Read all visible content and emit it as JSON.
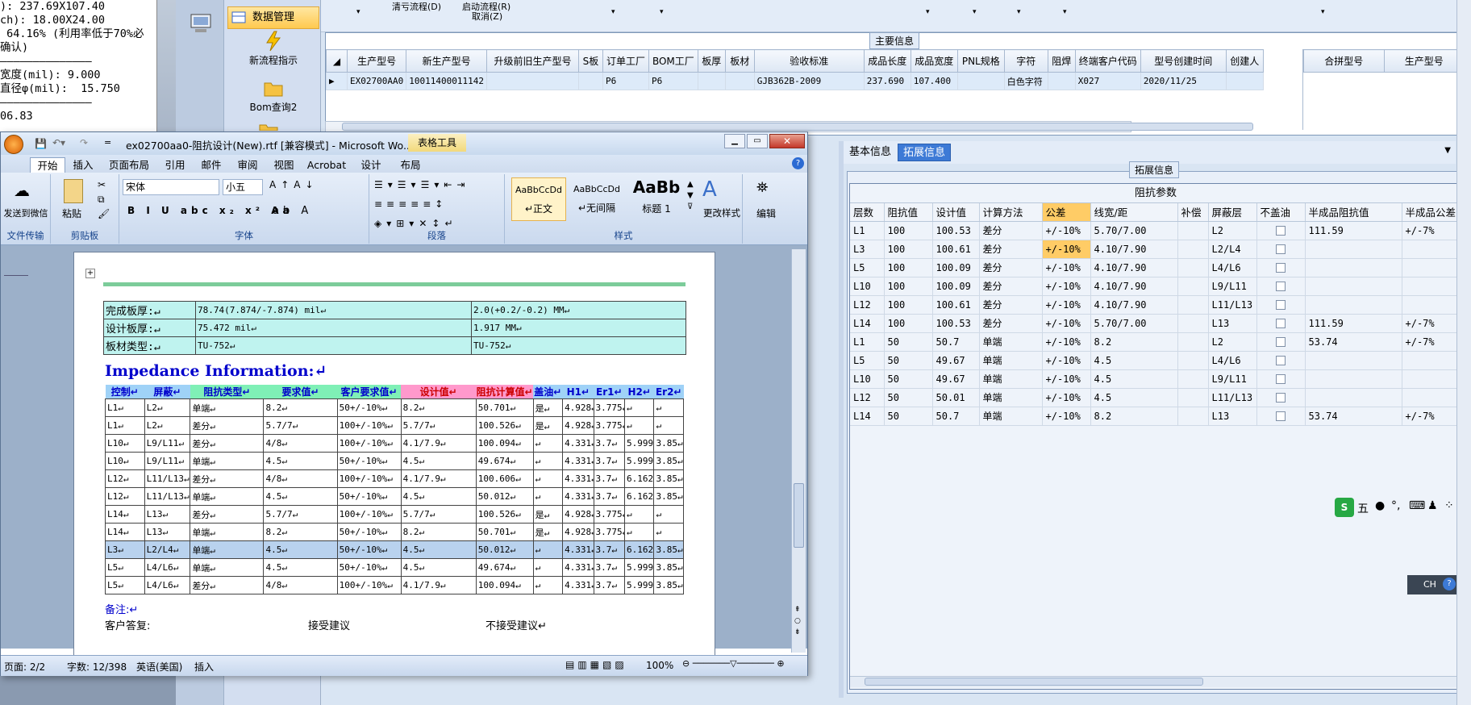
{
  "left_text": [
    "): 237.69X107.40",
    "ch): 18.00X24.00",
    " 64.16% (利用率低于70%必",
    "确认)",
    "——————————————",
    "宽度(mil): 9.000",
    "直径φ(mil):  15.750",
    "——————————————",
    "06.83"
  ],
  "nav": {
    "selected": "数据管理",
    "items": [
      "新流程指示",
      "Bom查询2"
    ]
  },
  "topbar": {
    "items": [
      "清亏流程(D)",
      "启动流程(R)",
      "取消(Z)"
    ]
  },
  "main": {
    "caption": "主要信息",
    "columns": [
      "生产型号",
      "新生产型号",
      "升级前旧生产型号",
      "S板",
      "订单工厂",
      "BOM工厂",
      "板厚",
      "板材",
      "验收标准",
      "成品长度",
      "成品宽度",
      "PNL规格",
      "字符",
      "阻焊",
      "终端客户代码",
      "型号创建时间",
      "创建人"
    ],
    "row": [
      "EX02700AA0",
      "10011400011142",
      "",
      "",
      "P6",
      "P6",
      "",
      "",
      "GJB362B-2009",
      "237.690",
      "107.400",
      "",
      "白色字符",
      "",
      "X027",
      "2020/11/25",
      ""
    ],
    "right_columns": [
      "合拼型号",
      "生产型号"
    ]
  },
  "panel2": {
    "tabs": [
      "基本信息",
      "拓展信息"
    ],
    "active": "拓展信息",
    "caption": "拓展信息",
    "grid_title": "阻抗参数",
    "columns": [
      "层数",
      "阻抗值",
      "设计值",
      "计算方法",
      "公差",
      "线宽/距",
      "补偿",
      "屏蔽层",
      "不盖油",
      "半成品阻抗值",
      "半成品公差"
    ],
    "rows": [
      [
        "L1",
        "100",
        "100.53",
        "差分",
        "+/-10%",
        "5.70/7.00",
        "",
        "L2",
        "",
        "111.59",
        "+/-7%"
      ],
      [
        "L3",
        "100",
        "100.61",
        "差分",
        "+/-10%",
        "4.10/7.90",
        "",
        "L2/L4",
        "",
        "",
        ""
      ],
      [
        "L5",
        "100",
        "100.09",
        "差分",
        "+/-10%",
        "4.10/7.90",
        "",
        "L4/L6",
        "",
        "",
        ""
      ],
      [
        "L10",
        "100",
        "100.09",
        "差分",
        "+/-10%",
        "4.10/7.90",
        "",
        "L9/L11",
        "",
        "",
        ""
      ],
      [
        "L12",
        "100",
        "100.61",
        "差分",
        "+/-10%",
        "4.10/7.90",
        "",
        "L11/L13",
        "",
        "",
        ""
      ],
      [
        "L14",
        "100",
        "100.53",
        "差分",
        "+/-10%",
        "5.70/7.00",
        "",
        "L13",
        "",
        "111.59",
        "+/-7%"
      ],
      [
        "L1",
        "50",
        "50.7",
        "单端",
        "+/-10%",
        "8.2",
        "",
        "L2",
        "",
        "53.74",
        "+/-7%"
      ],
      [
        "L5",
        "50",
        "49.67",
        "单端",
        "+/-10%",
        "4.5",
        "",
        "L4/L6",
        "",
        "",
        ""
      ],
      [
        "L10",
        "50",
        "49.67",
        "单端",
        "+/-10%",
        "4.5",
        "",
        "L9/L11",
        "",
        "",
        ""
      ],
      [
        "L12",
        "50",
        "50.01",
        "单端",
        "+/-10%",
        "4.5",
        "",
        "L11/L13",
        "",
        "",
        ""
      ],
      [
        "L14",
        "50",
        "50.7",
        "单端",
        "+/-10%",
        "8.2",
        "",
        "L13",
        "",
        "53.74",
        "+/-7%"
      ]
    ]
  },
  "word": {
    "title": "ex02700aa0-阻抗设计(New).rtf [兼容模式] - Microsoft Wo...",
    "context_tab": "表格工具",
    "tabs": [
      "开始",
      "插入",
      "页面布局",
      "引用",
      "邮件",
      "审阅",
      "视图",
      "Acrobat",
      "设计",
      "布局"
    ],
    "font": "宋体",
    "size": "小五",
    "groups": [
      "文件传输",
      "剪贴板",
      "字体",
      "段落",
      "样式",
      "编辑"
    ],
    "send_label": "发送到微信",
    "paste_label": "粘贴",
    "change_style": "更改样式",
    "edit_label": "编辑",
    "styles": [
      {
        "sample": "AaBbCcDd",
        "name": "↵正文"
      },
      {
        "sample": "AaBbCcDd",
        "name": "↵无间隔"
      },
      {
        "sample": "AaBb",
        "name": "标题 1"
      }
    ],
    "info": [
      [
        "完成板厚:↵",
        "78.74(7.874/-7.874) mil↵",
        "2.0(+0.2/-0.2) MM↵"
      ],
      [
        "设计板厚:↵",
        "75.472 mil↵",
        "1.917 MM↵"
      ],
      [
        "板材类型:↵",
        "TU-752↵",
        "TU-752↵"
      ]
    ],
    "impedance_title": "Impedance Information:↵",
    "imp_headers": [
      "控制↵",
      "屏蔽↵",
      "阻抗类型↵",
      "要求值↵",
      "客户要求值↵",
      "设计值↵",
      "阻抗计算值↵",
      "盖油↵",
      "H1↵",
      "Er1↵",
      "H2↵",
      "Er2↵"
    ],
    "imp_rows": [
      [
        "L1↵",
        "L2↵",
        "单端↵",
        "8.2↵",
        "50+/-10%↵",
        "8.2↵",
        "50.701↵",
        "是↵",
        "4.928↵",
        "3.775↵",
        "↵",
        "↵"
      ],
      [
        "L1↵",
        "L2↵",
        "差分↵",
        "5.7/7↵",
        "100+/-10%↵",
        "5.7/7↵",
        "100.526↵",
        "是↵",
        "4.928↵",
        "3.775↵",
        "↵",
        "↵"
      ],
      [
        "L10↵",
        "L9/L11↵",
        "差分↵",
        "4/8↵",
        "100+/-10%↵",
        "4.1/7.9↵",
        "100.094↵",
        "↵",
        "4.331↵",
        "3.7↵",
        "5.999↵",
        "3.85↵"
      ],
      [
        "L10↵",
        "L9/L11↵",
        "单端↵",
        "4.5↵",
        "50+/-10%↵",
        "4.5↵",
        "49.674↵",
        "↵",
        "4.331↵",
        "3.7↵",
        "5.999↵",
        "3.85↵"
      ],
      [
        "L12↵",
        "L11/L13↵",
        "差分↵",
        "4/8↵",
        "100+/-10%↵",
        "4.1/7.9↵",
        "100.606↵",
        "↵",
        "4.331↵",
        "3.7↵",
        "6.162↵",
        "3.85↵"
      ],
      [
        "L12↵",
        "L11/L13↵",
        "单端↵",
        "4.5↵",
        "50+/-10%↵",
        "4.5↵",
        "50.012↵",
        "↵",
        "4.331↵",
        "3.7↵",
        "6.162↵",
        "3.85↵"
      ],
      [
        "L14↵",
        "L13↵",
        "差分↵",
        "5.7/7↵",
        "100+/-10%↵",
        "5.7/7↵",
        "100.526↵",
        "是↵",
        "4.928↵",
        "3.775↵",
        "↵",
        "↵"
      ],
      [
        "L14↵",
        "L13↵",
        "单端↵",
        "8.2↵",
        "50+/-10%↵",
        "8.2↵",
        "50.701↵",
        "是↵",
        "4.928↵",
        "3.775↵",
        "↵",
        "↵"
      ],
      [
        "L3↵",
        "L2/L4↵",
        "单端↵",
        "4.5↵",
        "50+/-10%↵",
        "4.5↵",
        "50.012↵",
        "↵",
        "4.331↵",
        "3.7↵",
        "6.162↵",
        "3.85↵"
      ],
      [
        "L5↵",
        "L4/L6↵",
        "单端↵",
        "4.5↵",
        "50+/-10%↵",
        "4.5↵",
        "49.674↵",
        "↵",
        "4.331↵",
        "3.7↵",
        "5.999↵",
        "3.85↵"
      ],
      [
        "L5↵",
        "L4/L6↵",
        "差分↵",
        "4/8↵",
        "100+/-10%↵",
        "4.1/7.9↵",
        "100.094↵",
        "↵",
        "4.331↵",
        "3.7↵",
        "5.999↵",
        "3.85↵"
      ]
    ],
    "remark": "备注:↵",
    "customer_reply": "客户答复:",
    "accept": "接受建议",
    "reject": "不接受建议↵",
    "status": {
      "page": "页面: 2/2",
      "words": "字数: 12/398",
      "lang": "英语(美国)",
      "mode": "插入",
      "zoom": "100%"
    }
  },
  "ime": {
    "label": "五",
    "ch": "CH"
  },
  "colors": {
    "highlight": "#ffcc66",
    "selected_tab": "#3d7ad6",
    "mint": "#bff3ef",
    "impedance_title": "#0000cc"
  }
}
